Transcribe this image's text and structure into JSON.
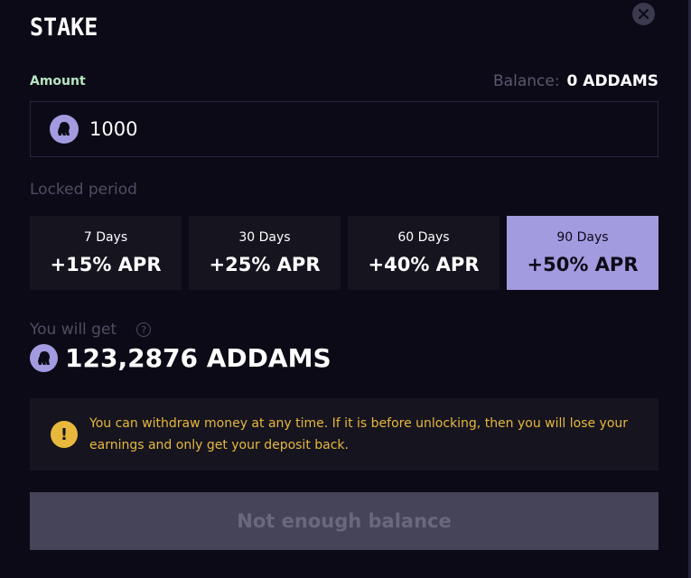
{
  "title": "STAKE",
  "amount": {
    "label": "Amount",
    "balance_label": "Balance:",
    "balance_value": "0 ADDAMS",
    "value": "1000",
    "token_icon": "gorilla-token-icon"
  },
  "locked_period": {
    "label": "Locked period",
    "options": [
      {
        "days": "7 Days",
        "apr": "+15% APR",
        "selected": false
      },
      {
        "days": "30 Days",
        "apr": "+25% APR",
        "selected": false
      },
      {
        "days": "60 Days",
        "apr": "+40% APR",
        "selected": false
      },
      {
        "days": "90 Days",
        "apr": "+50% APR",
        "selected": true
      }
    ]
  },
  "receive": {
    "label": "You will get",
    "help_glyph": "?",
    "value": "123,2876 ADDAMS"
  },
  "warning": {
    "glyph": "!",
    "text": "You can withdraw money at any time. If it is before unlocking, then you will lose your earnings and only get your deposit back."
  },
  "submit": {
    "label": "Not enough balance",
    "enabled": false
  },
  "colors": {
    "background": "#0c0a16",
    "accent": "#a39be0",
    "amount_label": "#b6e5c2",
    "warning": "#e8b83c",
    "card": "#15141f",
    "button_disabled": "#464458"
  }
}
